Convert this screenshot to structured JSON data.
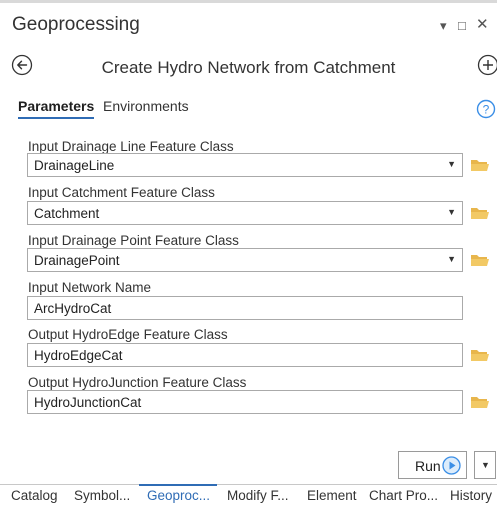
{
  "window": {
    "title": "Geoprocessing",
    "controls": {
      "pin": "▾",
      "maximize": "□",
      "close": "✕"
    }
  },
  "tool": {
    "title": "Create Hydro Network from Catchment"
  },
  "tabs": [
    {
      "label": "Parameters",
      "active": true
    },
    {
      "label": "Environments",
      "active": false
    }
  ],
  "parameters": [
    {
      "label": "Input Drainage Line Feature Class",
      "value": "DrainageLine",
      "control": "combo"
    },
    {
      "label": "Input Catchment Feature Class",
      "value": "Catchment",
      "control": "combo"
    },
    {
      "label": "Input Drainage Point Feature Class",
      "value": "DrainagePoint",
      "control": "combo"
    },
    {
      "label": "Input Network Name",
      "value": "ArcHydroCat",
      "control": "text"
    },
    {
      "label": "Output HydroEdge Feature Class",
      "value": "HydroEdgeCat",
      "control": "text-browse"
    },
    {
      "label": "Output HydroJunction Feature Class",
      "value": "HydroJunctionCat",
      "control": "text-browse"
    }
  ],
  "run": {
    "label": "Run"
  },
  "bottom_tabs": [
    {
      "label": "Catalog",
      "active": false
    },
    {
      "label": "Symbol...",
      "active": false
    },
    {
      "label": "Geoproc...",
      "active": true
    },
    {
      "label": "Modify F...",
      "active": false
    },
    {
      "label": "Element",
      "active": false
    },
    {
      "label": "Chart Pro...",
      "active": false
    },
    {
      "label": "History",
      "active": false
    }
  ],
  "colors": {
    "accent": "#2f6cb5",
    "folder": "#e8b64c",
    "help": "#3a8ee6",
    "run_icon": "#3a8ee6"
  }
}
